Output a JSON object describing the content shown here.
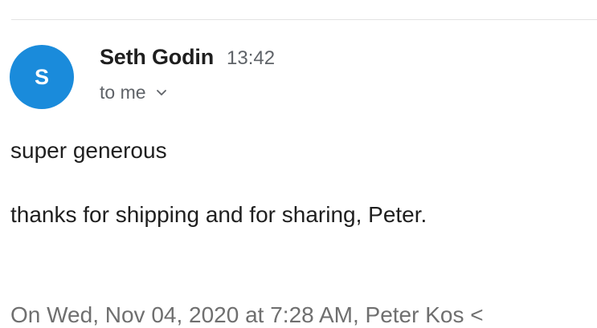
{
  "email": {
    "avatar_initial": "S",
    "avatar_color": "#1a8bdb",
    "sender_name": "Seth Godin",
    "time": "13:42",
    "recipient": "to me",
    "body_lines": [
      "super generous",
      "thanks for shipping and for sharing, Peter."
    ],
    "quoted_header": "On Wed, Nov 04, 2020 at 7:28 AM, Peter Kos <"
  },
  "icons": {
    "expand": "chevron-down-icon"
  }
}
